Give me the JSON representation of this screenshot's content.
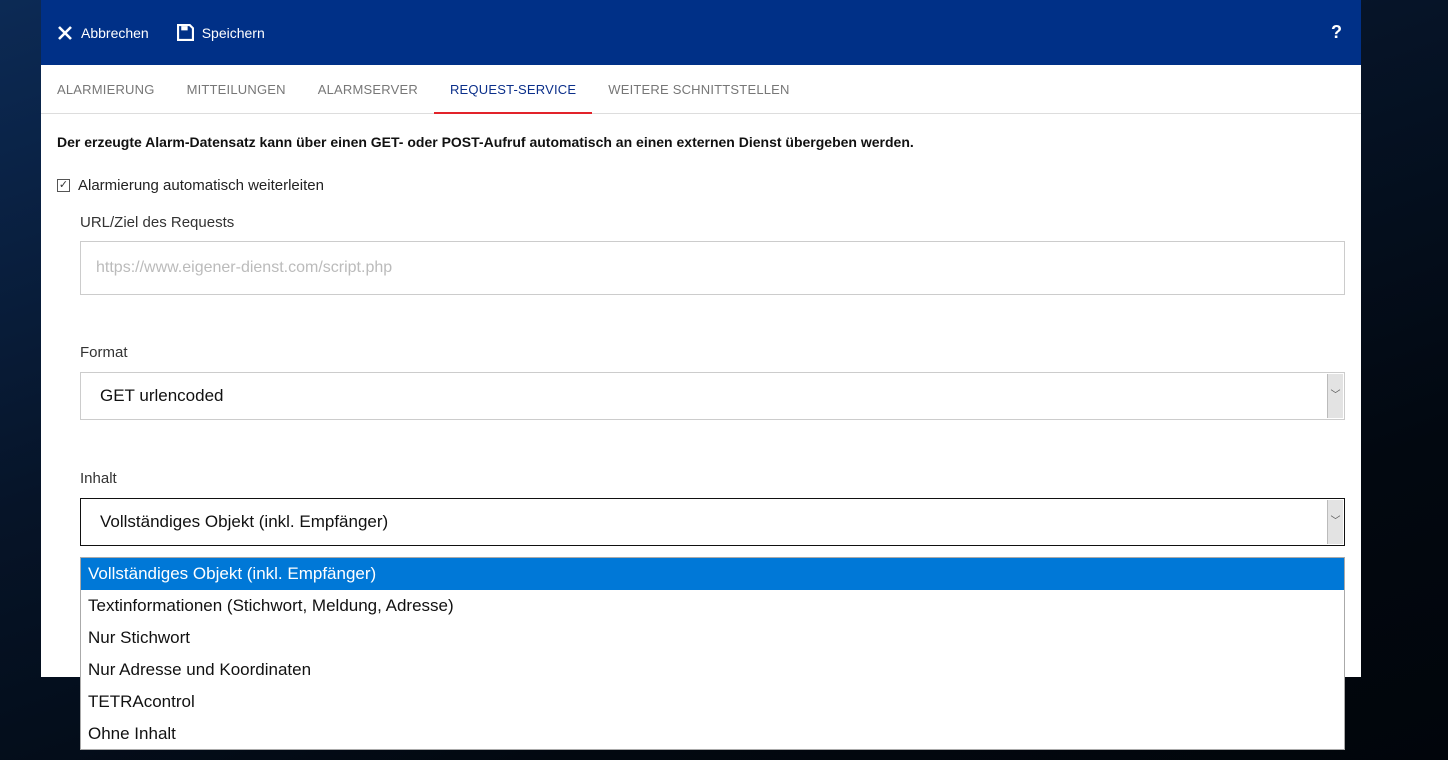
{
  "toolbar": {
    "cancel": "Abbrechen",
    "save": "Speichern",
    "help": "?"
  },
  "tabs": [
    "ALARMIERUNG",
    "MITTEILUNGEN",
    "ALARMSERVER",
    "REQUEST-SERVICE",
    "WEITERE SCHNITTSTELLEN"
  ],
  "description": "Der erzeugte Alarm-Datensatz kann über einen GET- oder POST-Aufruf automatisch an einen externen Dienst übergeben werden.",
  "forward": {
    "label": "Alarmierung automatisch weiterleiten",
    "checked": true,
    "mark": "☑"
  },
  "url": {
    "label": "URL/Ziel des Requests",
    "placeholder": "https://www.eigener-dienst.com/script.php",
    "value": ""
  },
  "format": {
    "label": "Format",
    "value": "GET urlencoded"
  },
  "content": {
    "label": "Inhalt",
    "value": "Vollständiges Objekt (inkl. Empfänger)",
    "options": [
      "Vollständiges Objekt (inkl. Empfänger)",
      "Textinformationen (Stichwort, Meldung, Adresse)",
      "Nur Stichwort",
      "Nur Adresse und Koordinaten",
      "TETRAcontrol",
      "Ohne Inhalt"
    ]
  }
}
